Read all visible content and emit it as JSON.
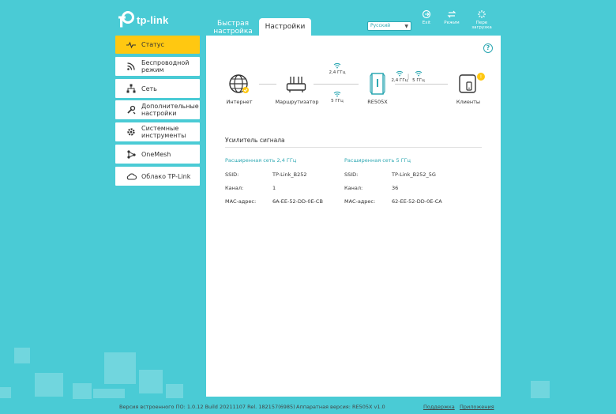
{
  "brand": {
    "logo_text": "tp-link"
  },
  "tabs": [
    {
      "label": "Быстрая настройка"
    },
    {
      "label": "Настройки"
    }
  ],
  "language": {
    "selected": "Русский"
  },
  "top_actions": [
    {
      "label": "Exit",
      "icon": "exit-icon"
    },
    {
      "label": "Режим",
      "icon": "mode-icon"
    },
    {
      "label": "Пере загрузка",
      "icon": "reboot-icon"
    }
  ],
  "sidebar": {
    "items": [
      {
        "label": "Статус",
        "icon": "pulse-icon",
        "active": true
      },
      {
        "label": "Беспроводной режим",
        "icon": "wireless-icon"
      },
      {
        "label": "Сеть",
        "icon": "network-icon"
      },
      {
        "label": "Дополнительные настройки",
        "icon": "advanced-icon"
      },
      {
        "label": "Системные инструменты",
        "icon": "tools-icon"
      },
      {
        "label": "OneMesh",
        "icon": "onemesh-icon"
      },
      {
        "label": "Облако TP-Link",
        "icon": "cloud-icon"
      }
    ]
  },
  "topology": {
    "internet": "Интернет",
    "router": "Маршрутизатор",
    "extender": "RE505X",
    "clients": "Клиенты",
    "uplink_24": "2,4 ГГц",
    "uplink_5": "5 ГГц",
    "downlink_24": "2,4 ГГц",
    "downlink_5": "5 ГГц",
    "separator": "|"
  },
  "extender_section": {
    "title": "Усилитель сигнала",
    "net24": {
      "heading": "Расширенная сеть 2,4 ГГц",
      "ssid_label": "SSID:",
      "ssid": "TP-Link_B252",
      "channel_label": "Канал:",
      "channel": "1",
      "mac_label": "MAC-адрес:",
      "mac": "6A-EE-52-DD-0E-CB"
    },
    "net5": {
      "heading": "Расширенная сеть 5 ГГц",
      "ssid_label": "SSID:",
      "ssid": "TP-Link_B252_5G",
      "channel_label": "Канал:",
      "channel": "36",
      "mac_label": "MAC-адрес:",
      "mac": "62-EE-52-DD-0E-CA"
    }
  },
  "footer": {
    "firmware": "Версия встроенного ПО: 1.0.12 Build 20211107 Rel. 182157(6985)",
    "hardware": "Аппаратная версия: RE505X v1.0",
    "support": "Поддержка",
    "apps": "Приложения"
  },
  "colors": {
    "background": "#4acbd5",
    "accent": "#2ea8b3",
    "active_item": "#ffc811",
    "badge": "#ffc811"
  }
}
